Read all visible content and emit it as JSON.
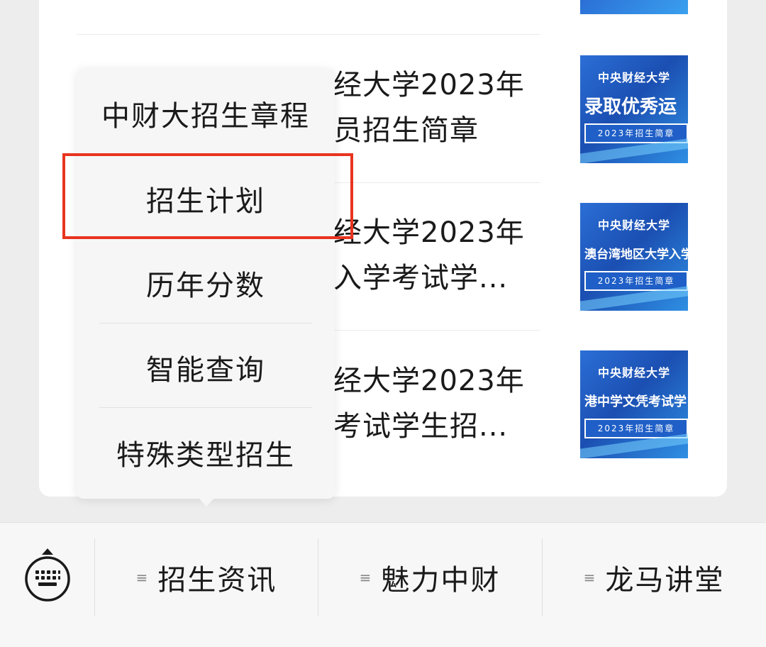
{
  "articles": [
    {
      "line1": "经大学2023年",
      "line2": "员招生简章",
      "thumb": {
        "org": "中央财经大学",
        "main": "录取优秀运",
        "band": "2023年招生简章"
      }
    },
    {
      "line1": "经大学2023年",
      "line2": "入学考试学...",
      "thumb": {
        "org": "中央财经大学",
        "main": "澳台湾地区大学入学",
        "band": "2023年招生简章"
      }
    },
    {
      "line1": "经大学2023年",
      "line2": "考试学生招...",
      "thumb": {
        "org": "中央财经大学",
        "main": "港中学文凭考试学",
        "band": "2023年招生简章"
      }
    }
  ],
  "popup_menu": {
    "items": [
      "中财大招生章程",
      "招生计划",
      "历年分数",
      "智能查询",
      "特殊类型招生"
    ],
    "highlighted_index": 1,
    "highlight_color": "#e8341f"
  },
  "bottom_menu": {
    "keyboard_icon": "keyboard-icon",
    "tabs": [
      {
        "label": "招生资讯",
        "icon": "menu-lines-icon"
      },
      {
        "label": "魅力中财",
        "icon": "menu-lines-icon"
      },
      {
        "label": "龙马讲堂",
        "icon": "menu-lines-icon"
      }
    ]
  }
}
